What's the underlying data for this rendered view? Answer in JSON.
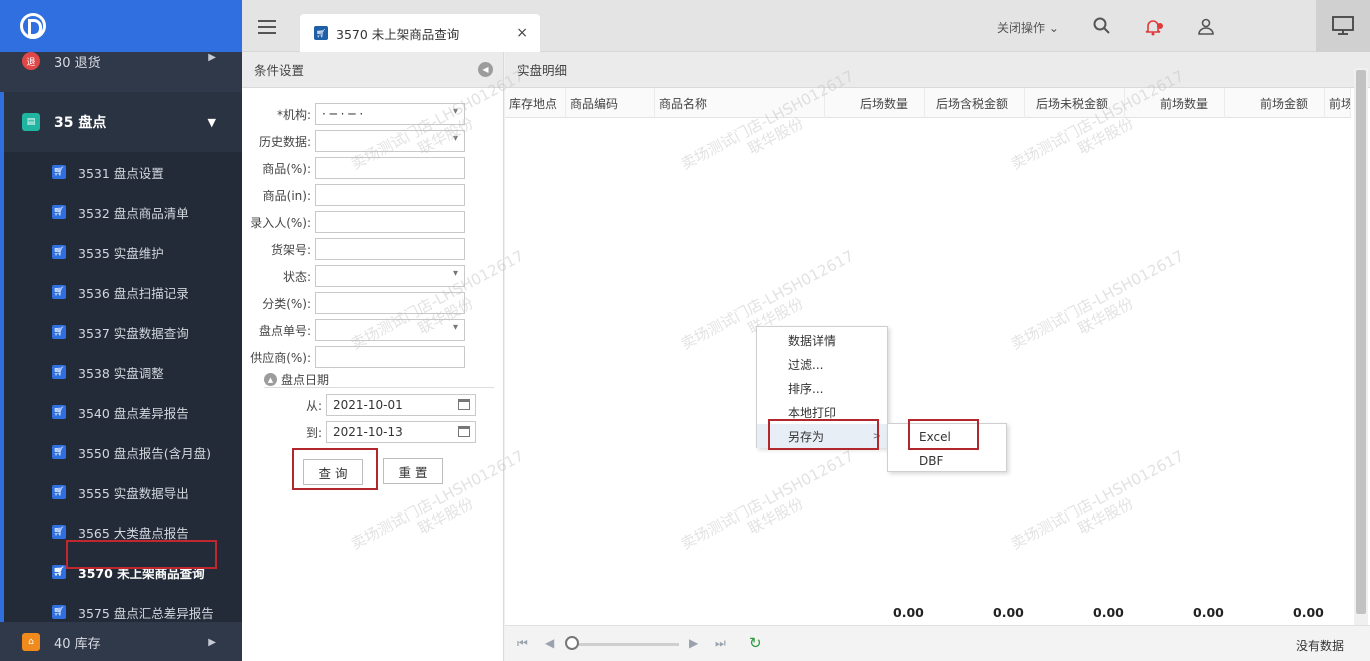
{
  "sidebar": {
    "groups": {
      "return": {
        "badge": "退",
        "label": "30 退货"
      },
      "inventory": {
        "label": "35 盘点"
      },
      "stock": {
        "label": "40 库存"
      }
    },
    "items": [
      {
        "label": "3531 盘点设置"
      },
      {
        "label": "3532 盘点商品清单"
      },
      {
        "label": "3535 实盘维护"
      },
      {
        "label": "3536 盘点扫描记录"
      },
      {
        "label": "3537 实盘数据查询"
      },
      {
        "label": "3538 实盘调整"
      },
      {
        "label": "3540 盘点差异报告"
      },
      {
        "label": "3550 盘点报告(含月盘)"
      },
      {
        "label": "3555 实盘数据导出"
      },
      {
        "label": "3565 大类盘点报告"
      },
      {
        "label": "3570 未上架商品查询"
      },
      {
        "label": "3575 盘点汇总差异报告"
      }
    ],
    "active_index": 10
  },
  "topbar": {
    "tab_label": "3570 未上架商品查询",
    "tab_close": "×",
    "close_ops": "关闭操作 ⌄"
  },
  "condition": {
    "title": "条件设置",
    "fields": [
      {
        "label": "*机构:",
        "type": "select",
        "value": "· ─ · ─ ·"
      },
      {
        "label": "历史数据:",
        "type": "select",
        "value": ""
      },
      {
        "label": "商品(%):",
        "type": "text",
        "value": ""
      },
      {
        "label": "商品(in):",
        "type": "text",
        "value": ""
      },
      {
        "label": "录入人(%):",
        "type": "text",
        "value": ""
      },
      {
        "label": "货架号:",
        "type": "text",
        "value": ""
      },
      {
        "label": "状态:",
        "type": "select",
        "value": ""
      },
      {
        "label": "分类(%):",
        "type": "text",
        "value": ""
      },
      {
        "label": "盘点单号:",
        "type": "select",
        "value": ""
      },
      {
        "label": "供应商(%):",
        "type": "text",
        "value": ""
      }
    ],
    "date_section": "盘点日期",
    "from_label": "从:",
    "from_value": "2021-10-01",
    "to_label": "到:",
    "to_value": "2021-10-13",
    "query_button": "查 询",
    "reset_button": "重 置"
  },
  "detail": {
    "title": "实盘明细",
    "columns": [
      "库存地点",
      "商品编码",
      "商品名称",
      "后场数量",
      "后场含税金额",
      "后场未税金额",
      "前场数量",
      "前场金额",
      "前场"
    ],
    "totals": [
      "0.00",
      "0.00",
      "0.00",
      "0.00",
      "0.00"
    ],
    "no_data": "没有数据"
  },
  "context_menu": {
    "items": [
      "数据详情",
      "过滤...",
      "排序...",
      "本地打印",
      "另存为"
    ],
    "save_as_options": [
      "Excel",
      "DBF"
    ]
  },
  "watermark": {
    "line1": "卖场测试门店-LHSH012617",
    "line2": "联华股份"
  }
}
